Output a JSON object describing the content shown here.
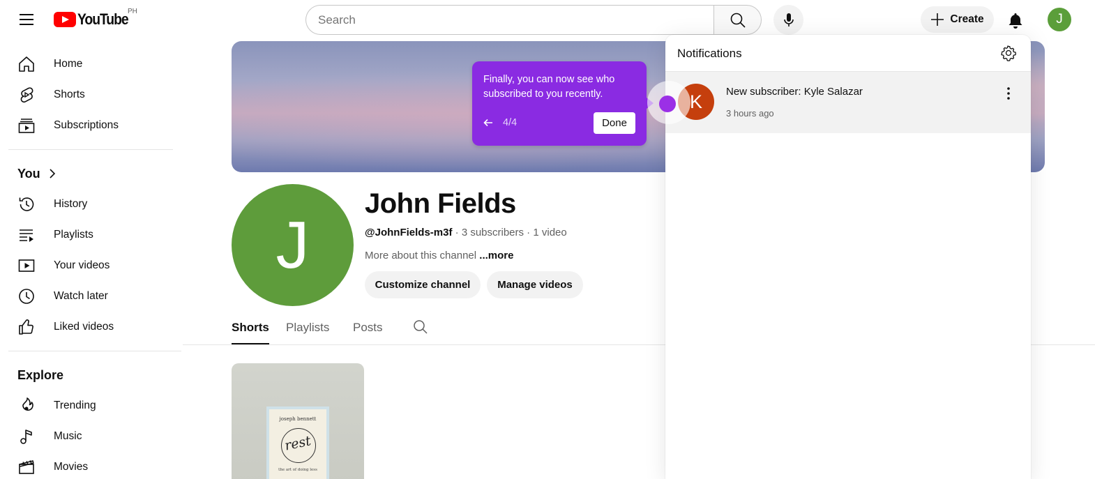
{
  "header": {
    "logo_text": "YouTube",
    "country": "PH",
    "search_placeholder": "Search",
    "create_label": "Create",
    "avatar_letter": "J"
  },
  "sidebar": {
    "main": [
      {
        "label": "Home",
        "icon": "home-icon"
      },
      {
        "label": "Shorts",
        "icon": "shorts-icon"
      },
      {
        "label": "Subscriptions",
        "icon": "subscriptions-icon"
      }
    ],
    "you_heading": "You",
    "you": [
      {
        "label": "History",
        "icon": "history-icon"
      },
      {
        "label": "Playlists",
        "icon": "playlists-icon"
      },
      {
        "label": "Your videos",
        "icon": "your-videos-icon"
      },
      {
        "label": "Watch later",
        "icon": "watch-later-icon"
      },
      {
        "label": "Liked videos",
        "icon": "liked-videos-icon"
      }
    ],
    "explore_heading": "Explore",
    "explore": [
      {
        "label": "Trending",
        "icon": "trending-icon"
      },
      {
        "label": "Music",
        "icon": "music-icon"
      },
      {
        "label": "Movies",
        "icon": "movies-icon"
      }
    ]
  },
  "channel": {
    "avatar_letter": "J",
    "name": "John Fields",
    "handle": "@JohnFields-m3f",
    "meta": " · 3 subscribers · 1 video",
    "about": "More about this channel ",
    "about_more": "...more",
    "customize_label": "Customize channel",
    "manage_label": "Manage videos",
    "tabs": [
      "Shorts",
      "Playlists",
      "Posts"
    ]
  },
  "short": {
    "author": "joseph bennett",
    "title": "rest",
    "subtitle": "the art of doing less"
  },
  "tooltip": {
    "message": "Finally, you can now see who subscribed to you recently.",
    "step": "4/4",
    "done_label": "Done"
  },
  "notifications": {
    "title": "Notifications",
    "items": [
      {
        "avatar_letter": "K",
        "text": "New subscriber: Kyle Salazar",
        "time": "3 hours ago"
      }
    ]
  },
  "colors": {
    "brand_red": "#ff0000",
    "tooltip_purple": "#8a2be2",
    "channel_avatar": "#5e9c3b",
    "notif_avatar": "#c53f0d"
  }
}
